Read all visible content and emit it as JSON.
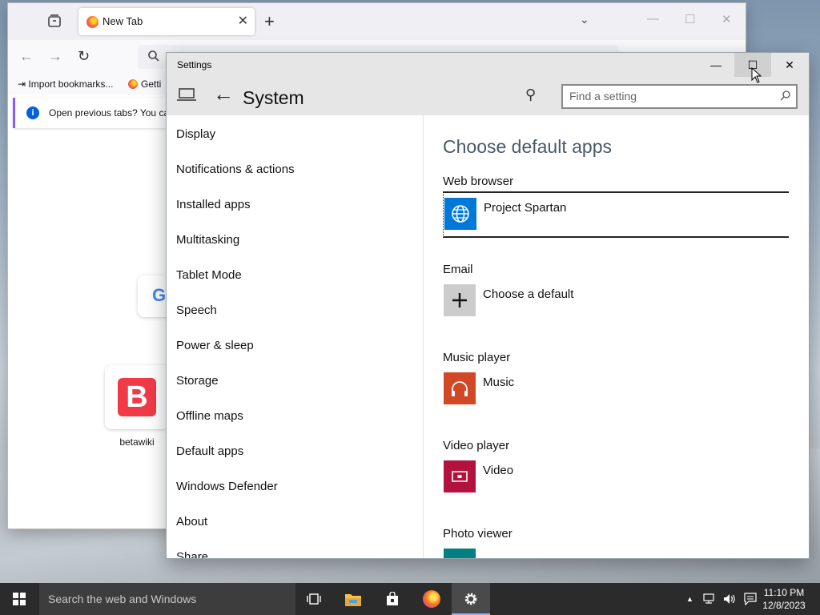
{
  "firefox": {
    "tab_title": "New Tab",
    "tab_close": "✕",
    "new_tab": "+",
    "list_tabs": "⌄",
    "win_min": "—",
    "win_max": "☐",
    "win_close": "✕",
    "back": "←",
    "forward": "→",
    "reload": "↻",
    "bookmarks": [
      "Import bookmarks...",
      "Getti"
    ],
    "info_icon": "i",
    "info_text": "Open previous tabs? You can",
    "google_letter": "G",
    "shortcut_logo_letter": "B",
    "shortcut_label": "betawiki"
  },
  "settings": {
    "window_title": "Settings",
    "win_min": "—",
    "win_max": "☐",
    "win_close": "✕",
    "back": "←",
    "page_title": "System",
    "pin": "⚲",
    "search_placeholder": "Find a setting",
    "nav_items": [
      "Display",
      "Notifications & actions",
      "Installed apps",
      "Multitasking",
      "Tablet Mode",
      "Speech",
      "Power & sleep",
      "Storage",
      "Offline maps",
      "Default apps",
      "Windows Defender",
      "About",
      "Share"
    ],
    "heading": "Choose default apps",
    "sections": [
      {
        "label": "Web browser",
        "app": "Project Spartan",
        "color": "#0078d7",
        "icon": "globe-icon"
      },
      {
        "label": "Email",
        "app": "Choose a default",
        "color": "#cccccc",
        "icon": "plus-icon"
      },
      {
        "label": "Music player",
        "app": "Music",
        "color": "#d24726",
        "icon": "headphones-icon"
      },
      {
        "label": "Video player",
        "app": "Video",
        "color": "#b3123f",
        "icon": "video-icon"
      },
      {
        "label": "Photo viewer",
        "app": "",
        "color": "#008080",
        "icon": "photo-icon"
      }
    ]
  },
  "taskbar": {
    "search_text": "Search the web and Windows",
    "tray_up": "▲",
    "time": "11:10 PM",
    "date": "12/8/2023"
  }
}
